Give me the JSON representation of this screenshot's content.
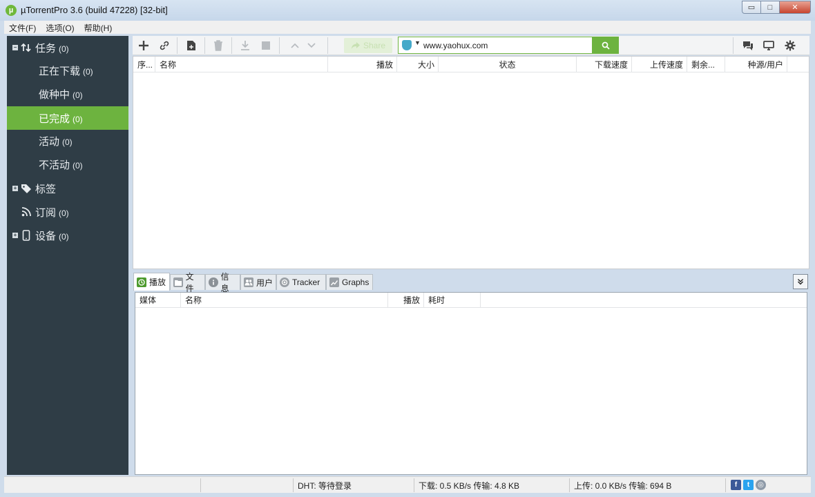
{
  "window": {
    "title": "µTorrentPro 3.6  (build 47228) [32-bit]",
    "app_icon": "µ",
    "minimize": "▭",
    "maximize": "□",
    "close": "✕"
  },
  "menu": [
    "文件(F)",
    "选项(O)",
    "帮助(H)"
  ],
  "sidebar": {
    "items": [
      {
        "label": "任务",
        "count": "(0)",
        "icon": "transfer-arrows-icon",
        "expander": "−"
      },
      {
        "label": "正在下载",
        "count": "(0)"
      },
      {
        "label": "做种中",
        "count": "(0)"
      },
      {
        "label": "已完成",
        "count": "(0)",
        "active": true
      },
      {
        "label": "活动",
        "count": "(0)"
      },
      {
        "label": "不活动",
        "count": "(0)"
      },
      {
        "label": "标签",
        "count": "",
        "icon": "tag-icon",
        "expander": "+"
      },
      {
        "label": "订阅",
        "count": "(0)",
        "icon": "rss-icon"
      },
      {
        "label": "设备",
        "count": "(0)",
        "icon": "device-icon",
        "expander": "+"
      }
    ],
    "accent": "#6db33f",
    "background": "#2f3d46"
  },
  "toolbar": {
    "share_label": "Share",
    "search_value": "www.yaohux.com",
    "icons": [
      "add-torrent-icon",
      "add-url-icon",
      "create-torrent-icon",
      "remove-icon",
      "download-icon",
      "stop-icon",
      "move-up-icon",
      "move-down-icon",
      "search-icon",
      "chat-icon",
      "remote-icon",
      "settings-icon"
    ]
  },
  "torrent_list": {
    "columns": [
      "序...",
      "名称",
      "播放",
      "大小",
      "状态",
      "下载速度",
      "上传速度",
      "剩余...",
      "种源/用户"
    ]
  },
  "detail_tabs": {
    "tabs": [
      {
        "label": "播放",
        "active": true
      },
      {
        "label": "文件"
      },
      {
        "label": "信息"
      },
      {
        "label": "用户"
      },
      {
        "label": "Tracker"
      },
      {
        "label": "Graphs"
      }
    ],
    "collapse": "⏷",
    "columns": [
      "媒体",
      "名称",
      "播放",
      "耗时"
    ]
  },
  "status": {
    "dht": "DHT: 等待登录",
    "download": "下载: 0.5 KB/s 传输: 4.8 KB",
    "upload": "上传: 0.0 KB/s 传输: 694 B",
    "facebook": "f",
    "twitter": "t",
    "web": "◎"
  }
}
